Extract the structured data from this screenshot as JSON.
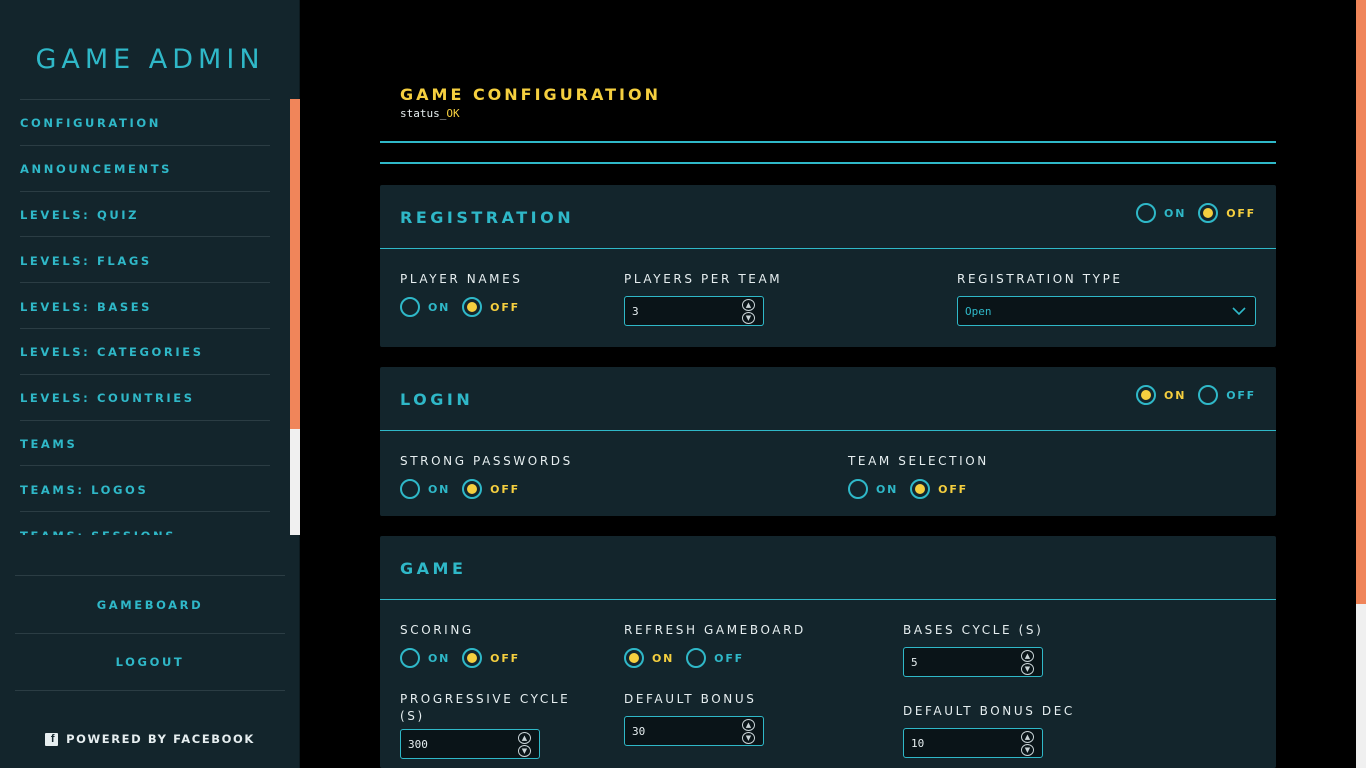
{
  "sidebar": {
    "title": "GAME ADMIN",
    "items": [
      {
        "label": "CONFIGURATION"
      },
      {
        "label": "ANNOUNCEMENTS"
      },
      {
        "label": "LEVELS: QUIZ"
      },
      {
        "label": "LEVELS: FLAGS"
      },
      {
        "label": "LEVELS: BASES"
      },
      {
        "label": "LEVELS: CATEGORIES"
      },
      {
        "label": "LEVELS: COUNTRIES"
      },
      {
        "label": "TEAMS"
      },
      {
        "label": "TEAMS: LOGOS"
      },
      {
        "label": "TEAMS: SESSIONS"
      }
    ],
    "gameboard": "GAMEBOARD",
    "logout": "LOGOUT",
    "powered": "POWERED BY FACEBOOK",
    "fb_icon": "facebook-icon"
  },
  "header": {
    "title": "GAME CONFIGURATION",
    "status_prefix": "status_",
    "status_value": "OK"
  },
  "colors": {
    "accent": "#2fb8c8",
    "highlight": "#f5cf3f",
    "panel": "#13252c",
    "scroll_thumb": "#f0855a"
  },
  "on_label": "ON",
  "off_label": "OFF",
  "registration": {
    "title": "REGISTRATION",
    "enabled": "OFF",
    "player_names": {
      "label": "PLAYER NAMES",
      "value": "OFF"
    },
    "players_per_team": {
      "label": "PLAYERS PER TEAM",
      "value": "3"
    },
    "registration_type": {
      "label": "REGISTRATION TYPE",
      "value": "Open"
    }
  },
  "login": {
    "title": "LOGIN",
    "enabled": "ON",
    "strong_passwords": {
      "label": "STRONG PASSWORDS",
      "value": "OFF"
    },
    "team_selection": {
      "label": "TEAM SELECTION",
      "value": "OFF"
    }
  },
  "game": {
    "title": "GAME",
    "scoring": {
      "label": "SCORING",
      "value": "OFF"
    },
    "refresh_gameboard": {
      "label": "REFRESH GAMEBOARD",
      "value": "ON"
    },
    "bases_cycle": {
      "label": "BASES CYCLE (S)",
      "value": "5"
    },
    "progressive_cycle": {
      "label": "PROGRESSIVE CYCLE (S)",
      "value": "300"
    },
    "default_bonus": {
      "label": "DEFAULT BONUS",
      "value": "30"
    },
    "default_bonus_dec": {
      "label": "DEFAULT BONUS DEC",
      "value": "10"
    }
  }
}
